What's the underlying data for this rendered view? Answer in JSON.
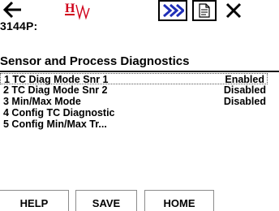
{
  "toolbar": {
    "back_icon": "left-arrow-icon",
    "logo_text": "HW",
    "more_icon": "double-chevron-right-icon",
    "doc_icon": "document-icon",
    "close_icon": "close-icon"
  },
  "header": {
    "device": "3144P:",
    "section": "Sensor and Process Diagnostics"
  },
  "menu": {
    "items": [
      {
        "label": "1 TC Diag Mode Snr 1",
        "value": "Enabled"
      },
      {
        "label": "2 TC Diag Mode Snr 2",
        "value": "Disabled"
      },
      {
        "label": "3 Min/Max Mode",
        "value": "Disabled"
      },
      {
        "label": "4 Config TC Diagnostic",
        "value": ""
      },
      {
        "label": "5 Config Min/Max Tr...",
        "value": ""
      }
    ]
  },
  "footer": {
    "help": "HELP",
    "save": "SAVE",
    "home": "HOME"
  },
  "colors": {
    "logo_red": "#d0021b",
    "accent_blue": "#1f2fb8",
    "text": "#000000"
  }
}
